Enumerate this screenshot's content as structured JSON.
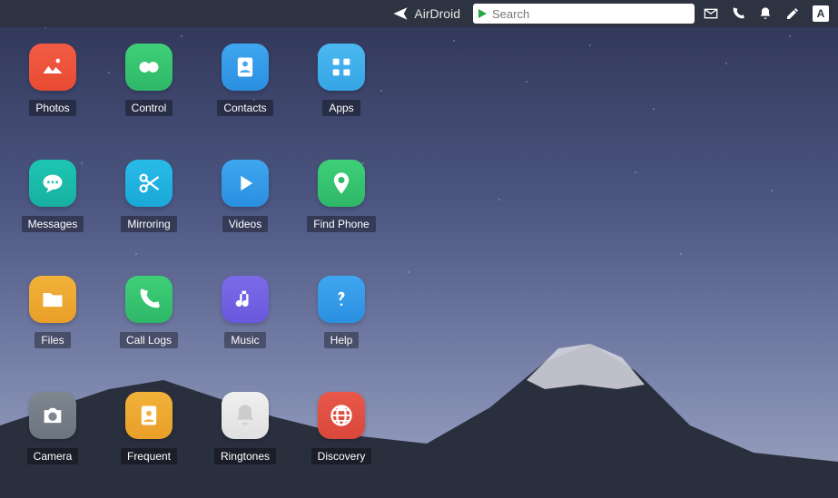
{
  "header": {
    "brand": "AirDroid",
    "search_placeholder": "Search",
    "user_initial": "A"
  },
  "apps": [
    {
      "id": "photos",
      "label": "Photos",
      "color": "c-orange",
      "icon": "photo"
    },
    {
      "id": "control",
      "label": "Control",
      "color": "c-green",
      "icon": "binoculars"
    },
    {
      "id": "contacts",
      "label": "Contacts",
      "color": "c-blue",
      "icon": "contact"
    },
    {
      "id": "apps",
      "label": "Apps",
      "color": "c-sky",
      "icon": "grid"
    },
    {
      "id": "messages",
      "label": "Messages",
      "color": "c-teal",
      "icon": "message"
    },
    {
      "id": "mirroring",
      "label": "Mirroring",
      "color": "c-cyan",
      "icon": "scissors"
    },
    {
      "id": "videos",
      "label": "Videos",
      "color": "c-blue",
      "icon": "play"
    },
    {
      "id": "findphone",
      "label": "Find Phone",
      "color": "c-green",
      "icon": "pin"
    },
    {
      "id": "files",
      "label": "Files",
      "color": "c-yellow",
      "icon": "folder"
    },
    {
      "id": "calllogs",
      "label": "Call Logs",
      "color": "c-green",
      "icon": "phone"
    },
    {
      "id": "music",
      "label": "Music",
      "color": "c-purple",
      "icon": "music"
    },
    {
      "id": "help",
      "label": "Help",
      "color": "c-blue",
      "icon": "question"
    },
    {
      "id": "camera",
      "label": "Camera",
      "color": "c-grey",
      "icon": "camera"
    },
    {
      "id": "frequent",
      "label": "Frequent",
      "color": "c-yellow",
      "icon": "starcontact"
    },
    {
      "id": "ringtones",
      "label": "Ringtones",
      "color": "c-white",
      "icon": "bell"
    },
    {
      "id": "discovery",
      "label": "Discovery",
      "color": "c-red",
      "icon": "globe"
    }
  ]
}
